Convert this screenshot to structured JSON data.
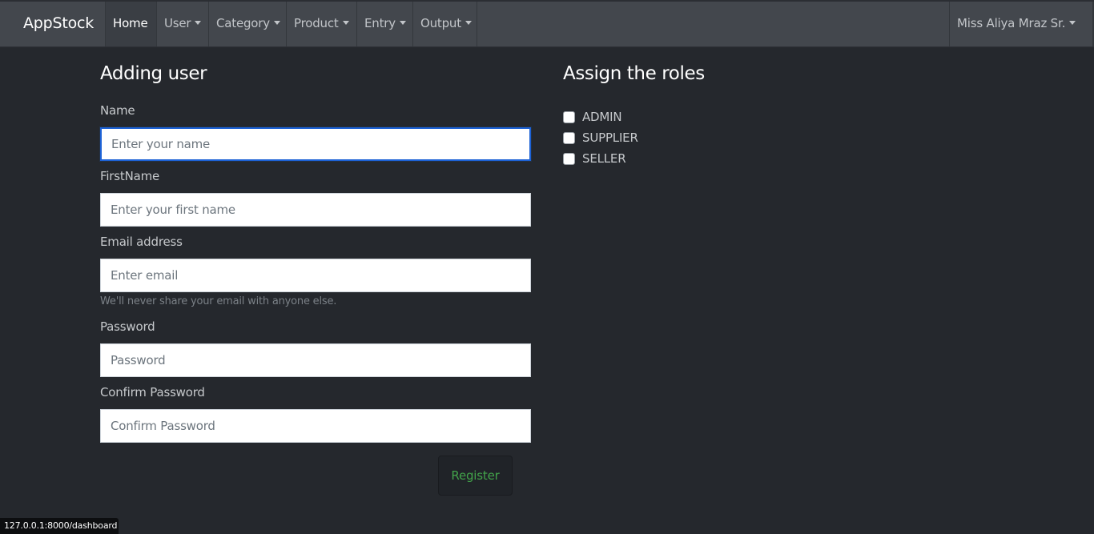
{
  "navbar": {
    "brand": "AppStock",
    "items": [
      {
        "label": "Home",
        "active": true,
        "dropdown": false
      },
      {
        "label": "User",
        "active": false,
        "dropdown": true
      },
      {
        "label": "Category",
        "active": false,
        "dropdown": true
      },
      {
        "label": "Product",
        "active": false,
        "dropdown": true
      },
      {
        "label": "Entry",
        "active": false,
        "dropdown": true
      },
      {
        "label": "Output",
        "active": false,
        "dropdown": true
      }
    ],
    "user_menu": "Miss Aliya Mraz Sr."
  },
  "form": {
    "title": "Adding user",
    "fields": [
      {
        "label": "Name",
        "value": "",
        "placeholder": "Enter your name",
        "focused": true
      },
      {
        "label": "FirstName",
        "value": "",
        "placeholder": "Enter your first name"
      },
      {
        "label": "Email address",
        "value": "",
        "placeholder": "Enter email",
        "help": "We'll never share your email with anyone else."
      },
      {
        "label": "Password",
        "value": "",
        "placeholder": "Password"
      },
      {
        "label": "Confirm Password",
        "value": "",
        "placeholder": "Confirm Password"
      }
    ],
    "submit_label": "Register"
  },
  "roles": {
    "title": "Assign the roles",
    "items": [
      {
        "label": "ADMIN",
        "checked": false
      },
      {
        "label": "SUPPLIER",
        "checked": false
      },
      {
        "label": "SELLER",
        "checked": false
      }
    ]
  },
  "status_bar": {
    "url": "127.0.0.1:8000/dashboard"
  },
  "colors": {
    "background": "#25282d",
    "navbar": "#43474d",
    "focus_border": "#1d62d6",
    "register_text": "#42a34a"
  }
}
